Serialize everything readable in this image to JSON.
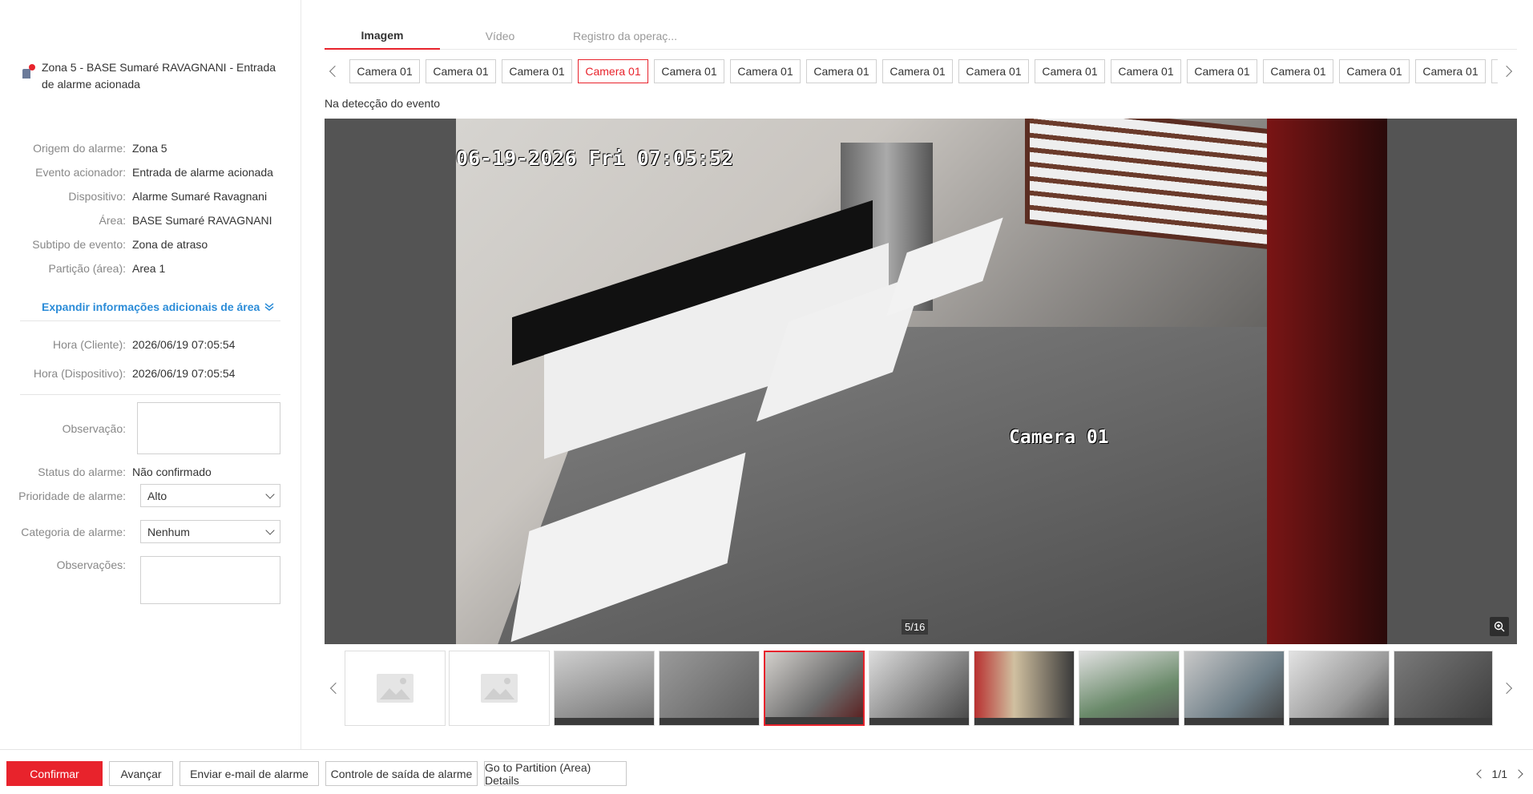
{
  "alarm": {
    "title": "Zona 5 - BASE Sumaré RAVAGNANI - Entrada de alarme acionada"
  },
  "details": [
    {
      "label": "Origem do alarme:",
      "value": "Zona 5"
    },
    {
      "label": "Evento acionador:",
      "value": "Entrada de alarme acionada"
    },
    {
      "label": "Dispositivo:",
      "value": "Alarme Sumaré Ravagnani"
    },
    {
      "label": "Área:",
      "value": "BASE Sumaré RAVAGNANI"
    },
    {
      "label": "Subtipo de evento:",
      "value": "Zona de atraso"
    },
    {
      "label": "Partição (área):",
      "value": "Area 1"
    }
  ],
  "expand_label": "Expandir informações adicionais de área",
  "times": [
    {
      "label": "Hora (Cliente):",
      "value": "2026/06/19 07:05:54"
    },
    {
      "label": "Hora (Dispositivo):",
      "value": "2026/06/19 07:05:54"
    }
  ],
  "form": {
    "observacao_label": "Observação:",
    "status_label": "Status do alarme:",
    "status_value": "Não confirmado",
    "priority_label": "Prioridade de alarme:",
    "priority_value": "Alto",
    "category_label": "Categoria de alarme:",
    "category_value": "Nenhum",
    "observacoes_label": "Observações:"
  },
  "tabs": [
    "Imagem",
    "Vídeo",
    "Registro da operaç..."
  ],
  "camera_tabs": [
    "Camera 01",
    "Camera 01",
    "Camera 01",
    "Camera 01",
    "Camera 01",
    "Camera 01",
    "Camera 01",
    "Camera 01",
    "Camera 01",
    "Camera 01",
    "Camera 01",
    "Camera 01",
    "Camera 01",
    "Camera 01",
    "Camera 01"
  ],
  "active_camera_index": 3,
  "detection_label": "Na detecção do evento",
  "viewer": {
    "osd_datetime": "06-19-2026 Fri 07:05:52",
    "osd_camera": "Camera 01",
    "counter": "5/16"
  },
  "thumbnails_active_index": 4,
  "footer": {
    "confirm": "Confirmar",
    "advance": "Avançar",
    "email": "Enviar e-mail de alarme",
    "output": "Controle de saída de alarme",
    "partition": "Go to Partition (Area) Details",
    "page": "1/1"
  },
  "colors": {
    "accent": "#e8232c",
    "link": "#2b8cd8"
  }
}
